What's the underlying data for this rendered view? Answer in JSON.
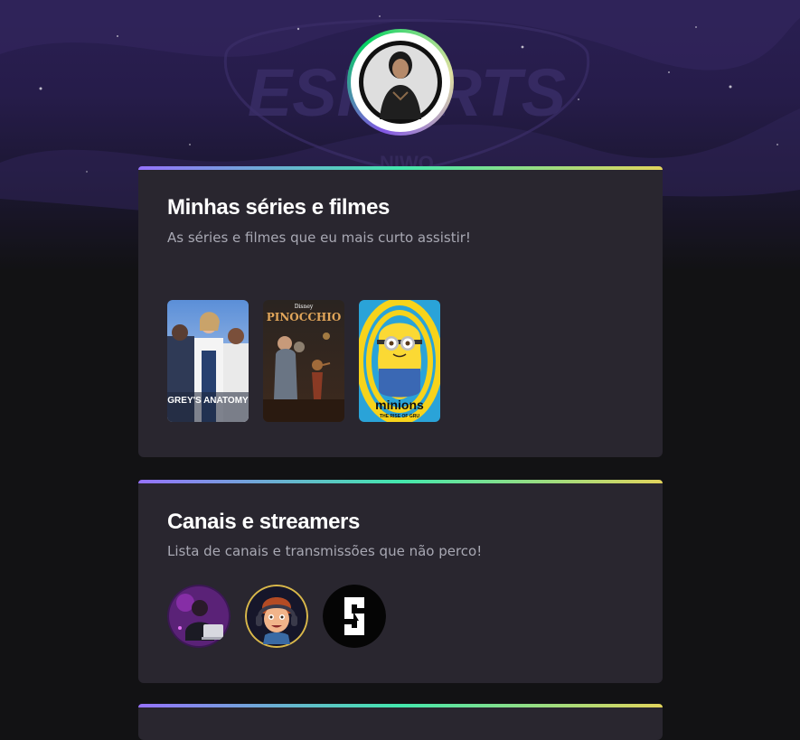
{
  "profile": {
    "avatar_icon": "profile-photo"
  },
  "background": {
    "watermark_text": "ESPORTS",
    "watermark_sub": "NIWO"
  },
  "colors": {
    "page_bg": "#121214",
    "card_bg": "#29262f",
    "title": "#ffffff",
    "subtitle": "#a8a8b3",
    "gradient": [
      "#9572fc",
      "#43e7ad",
      "#e2d45c"
    ]
  },
  "movies_section": {
    "title": "Minhas séries e filmes",
    "subtitle": "As séries e filmes que eu mais curto assistir!",
    "posters": [
      {
        "name": "Grey's Anatomy",
        "logo": "GREY'S ANATOMY"
      },
      {
        "name": "Pinocchio",
        "brand": "Disney",
        "logo": "PINOCCHIO"
      },
      {
        "name": "Minions",
        "logo": "minions",
        "tagline": "THE RISE OF GRU"
      }
    ]
  },
  "channels_section": {
    "title": "Canais e streamers",
    "subtitle": "Lista de canais e transmissões que não perco!",
    "channels": [
      {
        "icon": "streamer-with-laptop-avatar"
      },
      {
        "icon": "cartoon-gamer-avatar"
      },
      {
        "icon": "channel-logo-s"
      }
    ]
  }
}
